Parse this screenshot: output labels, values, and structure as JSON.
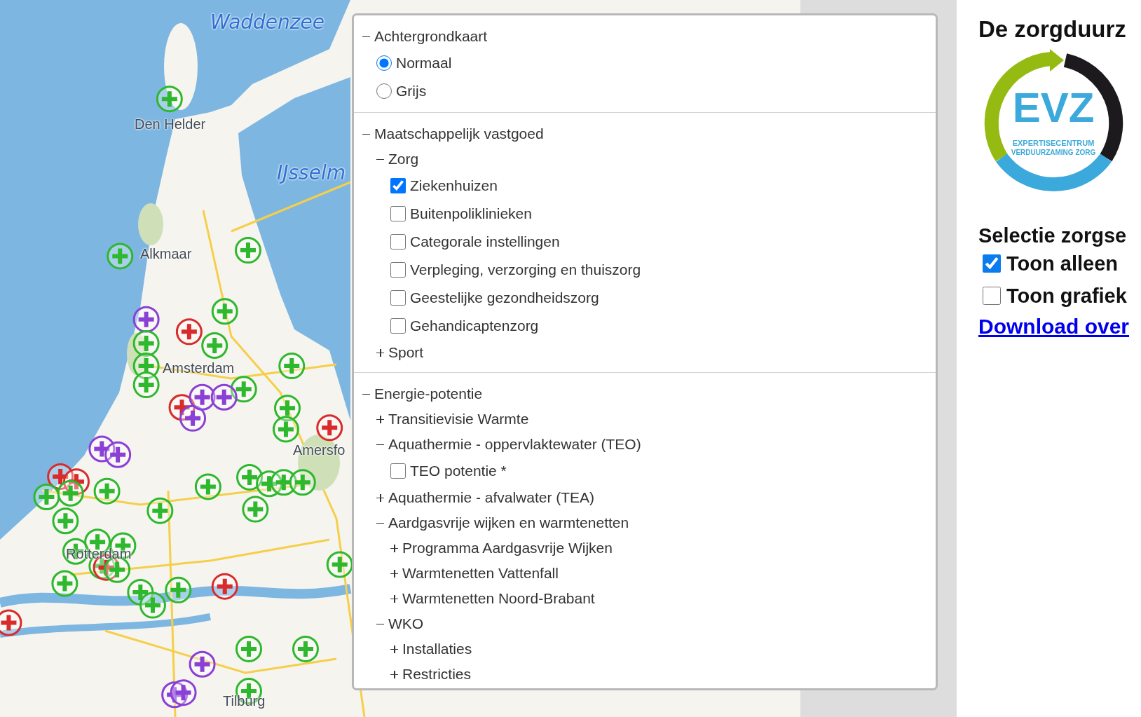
{
  "map": {
    "labels": [
      {
        "kind": "sea",
        "text": "Waddenzee"
      },
      {
        "kind": "sea",
        "text": "IJsselm"
      },
      {
        "kind": "city",
        "text": "Den Helder"
      },
      {
        "kind": "city",
        "text": "Alkmaar"
      },
      {
        "kind": "city",
        "text": "Amsterdam"
      },
      {
        "kind": "city",
        "text": "Amersfo"
      },
      {
        "kind": "city",
        "text": "Rotterdam"
      },
      {
        "kind": "city",
        "text": "Tilburg"
      }
    ]
  },
  "layer_control": {
    "sections": [
      {
        "label": "Achtergrondkaart",
        "expanded": true,
        "children": [
          {
            "kind": "radio",
            "label": "Normaal",
            "selected": true
          },
          {
            "kind": "radio",
            "label": "Grijs",
            "selected": false
          }
        ]
      },
      {
        "label": "Maatschappelijk vastgoed",
        "expanded": true,
        "children": [
          {
            "kind": "group",
            "label": "Zorg",
            "expanded": true,
            "children": [
              {
                "kind": "checkbox",
                "label": "Ziekenhuizen",
                "checked": true
              },
              {
                "kind": "checkbox",
                "label": "Buitenpoliklinieken",
                "checked": false
              },
              {
                "kind": "checkbox",
                "label": "Categorale instellingen",
                "checked": false
              },
              {
                "kind": "checkbox",
                "label": "Verpleging, verzorging en thuiszorg",
                "checked": false
              },
              {
                "kind": "checkbox",
                "label": "Geestelijke gezondheidszorg",
                "checked": false
              },
              {
                "kind": "checkbox",
                "label": "Gehandicaptenzorg",
                "checked": false
              }
            ]
          },
          {
            "kind": "group",
            "label": "Sport",
            "expanded": false
          }
        ]
      },
      {
        "label": "Energie-potentie",
        "expanded": true,
        "children": [
          {
            "kind": "group",
            "label": "Transitievisie Warmte",
            "expanded": false
          },
          {
            "kind": "group",
            "label": "Aquathermie - oppervlaktewater (TEO)",
            "expanded": true,
            "children": [
              {
                "kind": "checkbox",
                "label": "TEO potentie *",
                "checked": false
              }
            ]
          },
          {
            "kind": "group",
            "label": "Aquathermie - afvalwater (TEA)",
            "expanded": false
          },
          {
            "kind": "group",
            "label": "Aardgasvrije wijken en warmtenetten",
            "expanded": true,
            "children": [
              {
                "kind": "group",
                "label": "Programma Aardgasvrije Wijken",
                "expanded": false
              },
              {
                "kind": "group",
                "label": "Warmtenetten Vattenfall",
                "expanded": false
              },
              {
                "kind": "group",
                "label": "Warmtenetten Noord-Brabant",
                "expanded": false
              }
            ]
          },
          {
            "kind": "group",
            "label": "WKO",
            "expanded": true,
            "children": [
              {
                "kind": "group",
                "label": "Installaties",
                "expanded": false
              },
              {
                "kind": "group",
                "label": "Restricties",
                "expanded": false
              }
            ]
          }
        ]
      }
    ]
  },
  "side_panel": {
    "title": "De zorgduurz",
    "logo": {
      "abbr": "EVZ",
      "line_1": "EXPERTISECENTRUM",
      "line_2": "VERDUURZAMING ZORG"
    },
    "selection_title": "Selectie zorgse",
    "options": [
      {
        "label": "Toon alleen",
        "checked": true
      },
      {
        "label": "Toon grafiek",
        "checked": false
      }
    ],
    "download_link": "Download over"
  }
}
